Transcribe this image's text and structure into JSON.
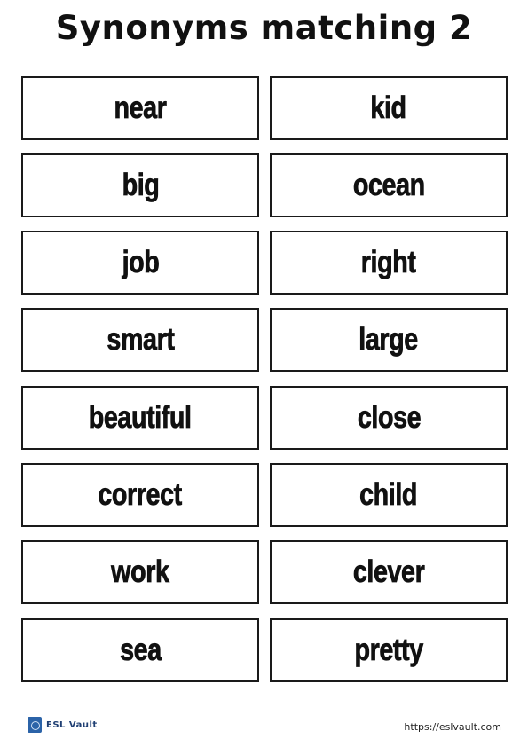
{
  "title": "Synonyms matching 2",
  "left_words": [
    "near",
    "big",
    "job",
    "smart",
    "beautiful",
    "correct",
    "work",
    "sea"
  ],
  "right_words": [
    "kid",
    "ocean",
    "right",
    "large",
    "close",
    "child",
    "clever",
    "pretty"
  ],
  "footer": {
    "brand": "ESL Vault",
    "url": "https://eslvault.com"
  }
}
